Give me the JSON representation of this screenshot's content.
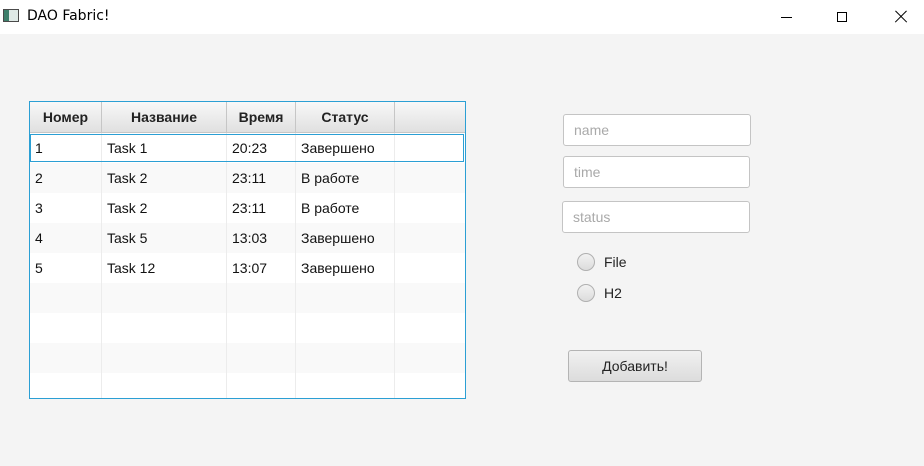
{
  "window": {
    "title": "DAO Fabric!",
    "minimize_glyph": "minimize-icon",
    "maximize_glyph": "maximize-icon",
    "close_glyph": "close-icon"
  },
  "table": {
    "columns": [
      "Номер",
      "Название",
      "Время",
      "Статус",
      ""
    ],
    "rows": [
      [
        "1",
        "Task 1",
        "20:23",
        "Завершено"
      ],
      [
        "2",
        "Task 2",
        "23:11",
        "В работе"
      ],
      [
        "3",
        "Task 2",
        "23:11",
        "В работе"
      ],
      [
        "4",
        "Task 5",
        "13:03",
        "Завершено"
      ],
      [
        "5",
        "Task 12",
        "13:07",
        "Завершено"
      ]
    ],
    "selected_row_index": 0,
    "accent_color": "#2b9fd4"
  },
  "form": {
    "name_placeholder": "name",
    "time_placeholder": "time",
    "status_placeholder": "status",
    "name_value": "",
    "time_value": "",
    "status_value": "",
    "radio_options": [
      "File",
      "H2"
    ],
    "submit_label": "Добавить!"
  }
}
